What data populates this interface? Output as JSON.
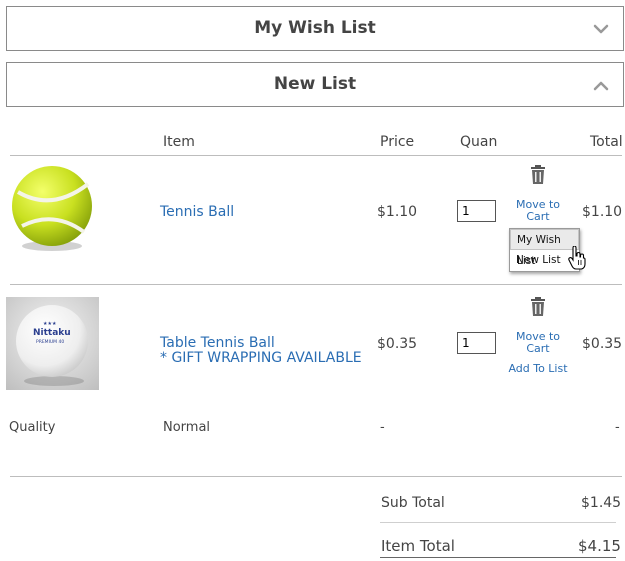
{
  "accordions": [
    {
      "title": "My Wish List",
      "state": "collapsed"
    },
    {
      "title": "New List",
      "state": "expanded"
    }
  ],
  "headers": {
    "item": "Item",
    "price": "Price",
    "quantity": "Quan",
    "total": "Total"
  },
  "items": [
    {
      "name": "Tennis Ball",
      "price": "$1.10",
      "quantity": "1",
      "total": "$1.10",
      "move_to_cart": "Move to Cart",
      "image_icon": "tennis-ball"
    },
    {
      "name": "Table Tennis Ball",
      "note": "* GIFT WRAPPING AVAILABLE",
      "price": "$0.35",
      "quantity": "1",
      "total": "$0.35",
      "move_to_cart": "Move to Cart",
      "add_to_list": "Add To List",
      "image_icon": "ping-pong-ball",
      "image_brand_text": "Nittaku",
      "image_sub_text": "PREMIUM 40"
    }
  ],
  "popup": {
    "options": [
      "My Wish List",
      "New List"
    ],
    "highlighted": "My Wish List"
  },
  "attribute": {
    "label": "Quality",
    "value": "Normal",
    "price": "-",
    "total": "-"
  },
  "summary": {
    "sub_total_label": "Sub Total",
    "sub_total": "$1.45",
    "item_total_label": "Item Total",
    "item_total": "$4.15"
  },
  "colors": {
    "link": "#2a6db3",
    "text": "#444444",
    "border": "#8a8a8a",
    "ball": "#c9e020"
  }
}
